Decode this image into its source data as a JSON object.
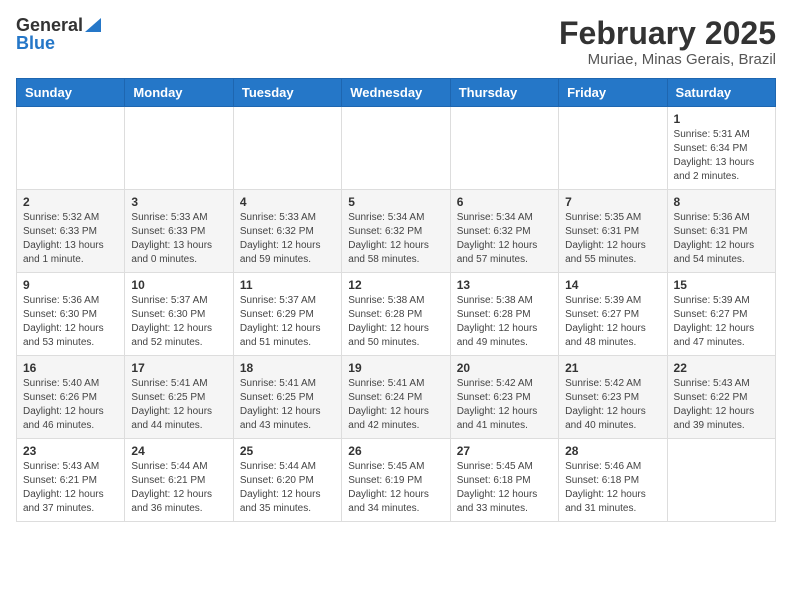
{
  "logo": {
    "general": "General",
    "blue": "Blue"
  },
  "title": {
    "month": "February 2025",
    "location": "Muriae, Minas Gerais, Brazil"
  },
  "days_of_week": [
    "Sunday",
    "Monday",
    "Tuesday",
    "Wednesday",
    "Thursday",
    "Friday",
    "Saturday"
  ],
  "weeks": [
    [
      {
        "day": "",
        "info": ""
      },
      {
        "day": "",
        "info": ""
      },
      {
        "day": "",
        "info": ""
      },
      {
        "day": "",
        "info": ""
      },
      {
        "day": "",
        "info": ""
      },
      {
        "day": "",
        "info": ""
      },
      {
        "day": "1",
        "info": "Sunrise: 5:31 AM\nSunset: 6:34 PM\nDaylight: 13 hours and 2 minutes."
      }
    ],
    [
      {
        "day": "2",
        "info": "Sunrise: 5:32 AM\nSunset: 6:33 PM\nDaylight: 13 hours and 1 minute."
      },
      {
        "day": "3",
        "info": "Sunrise: 5:33 AM\nSunset: 6:33 PM\nDaylight: 13 hours and 0 minutes."
      },
      {
        "day": "4",
        "info": "Sunrise: 5:33 AM\nSunset: 6:32 PM\nDaylight: 12 hours and 59 minutes."
      },
      {
        "day": "5",
        "info": "Sunrise: 5:34 AM\nSunset: 6:32 PM\nDaylight: 12 hours and 58 minutes."
      },
      {
        "day": "6",
        "info": "Sunrise: 5:34 AM\nSunset: 6:32 PM\nDaylight: 12 hours and 57 minutes."
      },
      {
        "day": "7",
        "info": "Sunrise: 5:35 AM\nSunset: 6:31 PM\nDaylight: 12 hours and 55 minutes."
      },
      {
        "day": "8",
        "info": "Sunrise: 5:36 AM\nSunset: 6:31 PM\nDaylight: 12 hours and 54 minutes."
      }
    ],
    [
      {
        "day": "9",
        "info": "Sunrise: 5:36 AM\nSunset: 6:30 PM\nDaylight: 12 hours and 53 minutes."
      },
      {
        "day": "10",
        "info": "Sunrise: 5:37 AM\nSunset: 6:30 PM\nDaylight: 12 hours and 52 minutes."
      },
      {
        "day": "11",
        "info": "Sunrise: 5:37 AM\nSunset: 6:29 PM\nDaylight: 12 hours and 51 minutes."
      },
      {
        "day": "12",
        "info": "Sunrise: 5:38 AM\nSunset: 6:28 PM\nDaylight: 12 hours and 50 minutes."
      },
      {
        "day": "13",
        "info": "Sunrise: 5:38 AM\nSunset: 6:28 PM\nDaylight: 12 hours and 49 minutes."
      },
      {
        "day": "14",
        "info": "Sunrise: 5:39 AM\nSunset: 6:27 PM\nDaylight: 12 hours and 48 minutes."
      },
      {
        "day": "15",
        "info": "Sunrise: 5:39 AM\nSunset: 6:27 PM\nDaylight: 12 hours and 47 minutes."
      }
    ],
    [
      {
        "day": "16",
        "info": "Sunrise: 5:40 AM\nSunset: 6:26 PM\nDaylight: 12 hours and 46 minutes."
      },
      {
        "day": "17",
        "info": "Sunrise: 5:41 AM\nSunset: 6:25 PM\nDaylight: 12 hours and 44 minutes."
      },
      {
        "day": "18",
        "info": "Sunrise: 5:41 AM\nSunset: 6:25 PM\nDaylight: 12 hours and 43 minutes."
      },
      {
        "day": "19",
        "info": "Sunrise: 5:41 AM\nSunset: 6:24 PM\nDaylight: 12 hours and 42 minutes."
      },
      {
        "day": "20",
        "info": "Sunrise: 5:42 AM\nSunset: 6:23 PM\nDaylight: 12 hours and 41 minutes."
      },
      {
        "day": "21",
        "info": "Sunrise: 5:42 AM\nSunset: 6:23 PM\nDaylight: 12 hours and 40 minutes."
      },
      {
        "day": "22",
        "info": "Sunrise: 5:43 AM\nSunset: 6:22 PM\nDaylight: 12 hours and 39 minutes."
      }
    ],
    [
      {
        "day": "23",
        "info": "Sunrise: 5:43 AM\nSunset: 6:21 PM\nDaylight: 12 hours and 37 minutes."
      },
      {
        "day": "24",
        "info": "Sunrise: 5:44 AM\nSunset: 6:21 PM\nDaylight: 12 hours and 36 minutes."
      },
      {
        "day": "25",
        "info": "Sunrise: 5:44 AM\nSunset: 6:20 PM\nDaylight: 12 hours and 35 minutes."
      },
      {
        "day": "26",
        "info": "Sunrise: 5:45 AM\nSunset: 6:19 PM\nDaylight: 12 hours and 34 minutes."
      },
      {
        "day": "27",
        "info": "Sunrise: 5:45 AM\nSunset: 6:18 PM\nDaylight: 12 hours and 33 minutes."
      },
      {
        "day": "28",
        "info": "Sunrise: 5:46 AM\nSunset: 6:18 PM\nDaylight: 12 hours and 31 minutes."
      },
      {
        "day": "",
        "info": ""
      }
    ]
  ]
}
